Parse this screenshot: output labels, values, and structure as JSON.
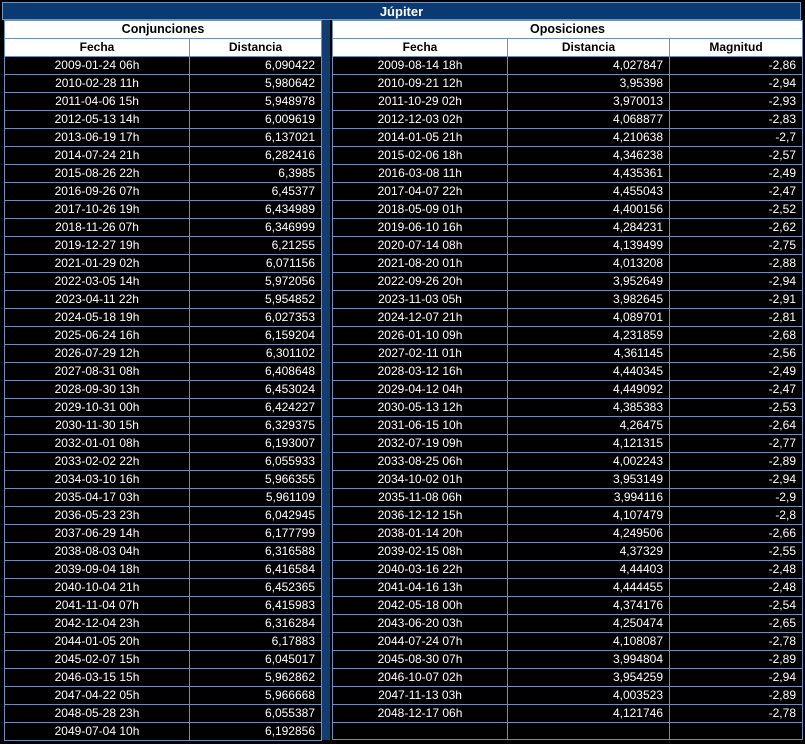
{
  "title": "Júpiter",
  "conjunciones": {
    "heading": "Conjunciones",
    "columns": [
      "Fecha",
      "Distancia"
    ],
    "rows": [
      [
        "2009-01-24 06h",
        "6,090422"
      ],
      [
        "2010-02-28 11h",
        "5,980642"
      ],
      [
        "2011-04-06 15h",
        "5,948978"
      ],
      [
        "2012-05-13 14h",
        "6,009619"
      ],
      [
        "2013-06-19 17h",
        "6,137021"
      ],
      [
        "2014-07-24 21h",
        "6,282416"
      ],
      [
        "2015-08-26 22h",
        "6,3985"
      ],
      [
        "2016-09-26 07h",
        "6,45377"
      ],
      [
        "2017-10-26 19h",
        "6,434989"
      ],
      [
        "2018-11-26 07h",
        "6,346999"
      ],
      [
        "2019-12-27 19h",
        "6,21255"
      ],
      [
        "2021-01-29 02h",
        "6,071156"
      ],
      [
        "2022-03-05 14h",
        "5,972056"
      ],
      [
        "2023-04-11 22h",
        "5,954852"
      ],
      [
        "2024-05-18 19h",
        "6,027353"
      ],
      [
        "2025-06-24 16h",
        "6,159204"
      ],
      [
        "2026-07-29 12h",
        "6,301102"
      ],
      [
        "2027-08-31 08h",
        "6,408648"
      ],
      [
        "2028-09-30 13h",
        "6,453024"
      ],
      [
        "2029-10-31 00h",
        "6,424227"
      ],
      [
        "2030-11-30 15h",
        "6,329375"
      ],
      [
        "2032-01-01 08h",
        "6,193007"
      ],
      [
        "2033-02-02 22h",
        "6,055933"
      ],
      [
        "2034-03-10 16h",
        "5,966355"
      ],
      [
        "2035-04-17 03h",
        "5,961109"
      ],
      [
        "2036-05-23 23h",
        "6,042945"
      ],
      [
        "2037-06-29 14h",
        "6,177799"
      ],
      [
        "2038-08-03 04h",
        "6,316588"
      ],
      [
        "2039-09-04 18h",
        "6,416584"
      ],
      [
        "2040-10-04 21h",
        "6,452365"
      ],
      [
        "2041-11-04 07h",
        "6,415983"
      ],
      [
        "2042-12-04 23h",
        "6,316284"
      ],
      [
        "2044-01-05 20h",
        "6,17883"
      ],
      [
        "2045-02-07 15h",
        "6,045017"
      ],
      [
        "2046-03-15 15h",
        "5,962862"
      ],
      [
        "2047-04-22 05h",
        "5,966668"
      ],
      [
        "2048-05-28 23h",
        "6,055387"
      ],
      [
        "2049-07-04 10h",
        "6,192856"
      ]
    ]
  },
  "oposiciones": {
    "heading": "Oposiciones",
    "columns": [
      "Fecha",
      "Distancia",
      "Magnitud"
    ],
    "rows": [
      [
        "2009-08-14 18h",
        "4,027847",
        "-2,86"
      ],
      [
        "2010-09-21 12h",
        "3,95398",
        "-2,94"
      ],
      [
        "2011-10-29 02h",
        "3,970013",
        "-2,93"
      ],
      [
        "2012-12-03 02h",
        "4,068877",
        "-2,83"
      ],
      [
        "2014-01-05 21h",
        "4,210638",
        "-2,7"
      ],
      [
        "2015-02-06 18h",
        "4,346238",
        "-2,57"
      ],
      [
        "2016-03-08 11h",
        "4,435361",
        "-2,49"
      ],
      [
        "2017-04-07 22h",
        "4,455043",
        "-2,47"
      ],
      [
        "2018-05-09 01h",
        "4,400156",
        "-2,52"
      ],
      [
        "2019-06-10 16h",
        "4,284231",
        "-2,62"
      ],
      [
        "2020-07-14 08h",
        "4,139499",
        "-2,75"
      ],
      [
        "2021-08-20 01h",
        "4,013208",
        "-2,88"
      ],
      [
        "2022-09-26 20h",
        "3,952649",
        "-2,94"
      ],
      [
        "2023-11-03 05h",
        "3,982645",
        "-2,91"
      ],
      [
        "2024-12-07 21h",
        "4,089701",
        "-2,81"
      ],
      [
        "2026-01-10 09h",
        "4,231859",
        "-2,68"
      ],
      [
        "2027-02-11 01h",
        "4,361145",
        "-2,56"
      ],
      [
        "2028-03-12 16h",
        "4,440345",
        "-2,49"
      ],
      [
        "2029-04-12 04h",
        "4,449092",
        "-2,47"
      ],
      [
        "2030-05-13 12h",
        "4,385383",
        "-2,53"
      ],
      [
        "2031-06-15 10h",
        "4,26475",
        "-2,64"
      ],
      [
        "2032-07-19 09h",
        "4,121315",
        "-2,77"
      ],
      [
        "2033-08-25 06h",
        "4,002243",
        "-2,89"
      ],
      [
        "2034-10-02 01h",
        "3,953149",
        "-2,94"
      ],
      [
        "2035-11-08 06h",
        "3,994116",
        "-2,9"
      ],
      [
        "2036-12-12 15h",
        "4,107479",
        "-2,8"
      ],
      [
        "2038-01-14 20h",
        "4,249506",
        "-2,66"
      ],
      [
        "2039-02-15 08h",
        "4,37329",
        "-2,55"
      ],
      [
        "2040-03-16 22h",
        "4,44403",
        "-2,48"
      ],
      [
        "2041-04-16 13h",
        "4,444455",
        "-2,48"
      ],
      [
        "2042-05-18 00h",
        "4,374176",
        "-2,54"
      ],
      [
        "2043-06-20 03h",
        "4,250474",
        "-2,65"
      ],
      [
        "2044-07-24 07h",
        "4,108087",
        "-2,78"
      ],
      [
        "2045-08-30 07h",
        "3,994804",
        "-2,89"
      ],
      [
        "2046-10-07 02h",
        "3,954259",
        "-2,94"
      ],
      [
        "2047-11-13 03h",
        "4,003523",
        "-2,89"
      ],
      [
        "2048-12-17 06h",
        "4,121746",
        "-2,78"
      ]
    ]
  }
}
